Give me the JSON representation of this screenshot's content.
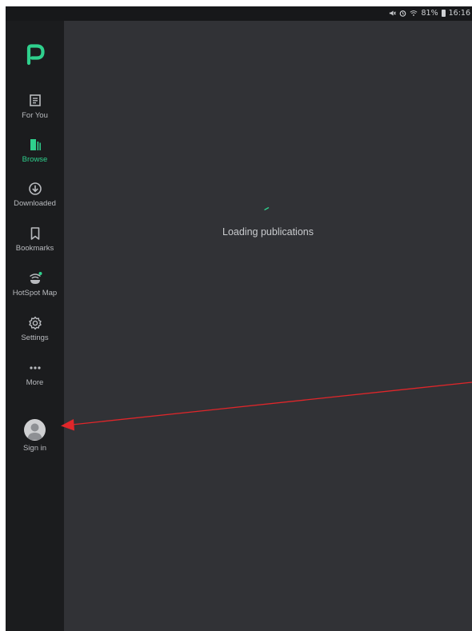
{
  "status_bar": {
    "battery_percent": "81%",
    "time": "16:16",
    "icons": [
      "mute-icon",
      "alarm-icon",
      "wifi-icon",
      "battery-icon"
    ]
  },
  "sidebar": {
    "logo": "p-logo-icon",
    "items": [
      {
        "label": "For You",
        "icon": "article-icon",
        "active": false
      },
      {
        "label": "Browse",
        "icon": "browse-icon",
        "active": true
      },
      {
        "label": "Downloaded",
        "icon": "download-icon",
        "active": false
      },
      {
        "label": "Bookmarks",
        "icon": "bookmark-icon",
        "active": false
      },
      {
        "label": "HotSpot Map",
        "icon": "hotspot-icon",
        "active": false
      },
      {
        "label": "Settings",
        "icon": "gear-icon",
        "active": false
      },
      {
        "label": "More",
        "icon": "more-icon",
        "active": false
      }
    ],
    "sign_in": {
      "label": "Sign in",
      "icon": "avatar-icon"
    }
  },
  "main": {
    "loading_text": "Loading publications"
  },
  "colors": {
    "accent": "#2fd08d",
    "sidebar_bg": "#1b1c1e",
    "content_bg": "#313236",
    "annotation_arrow": "#e0262a"
  }
}
